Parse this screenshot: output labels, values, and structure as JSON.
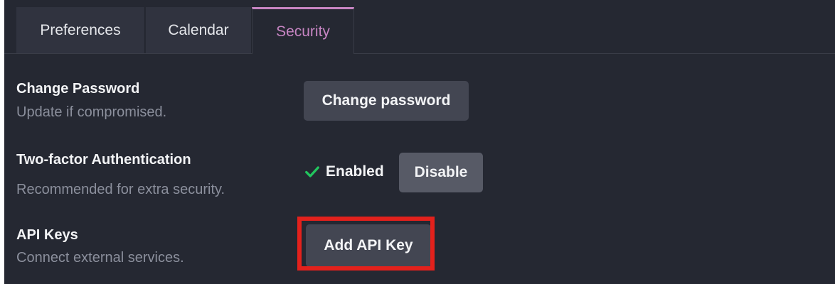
{
  "tabs": [
    {
      "label": "Preferences",
      "active": false
    },
    {
      "label": "Calendar",
      "active": false
    },
    {
      "label": "Security",
      "active": true
    }
  ],
  "security": {
    "password": {
      "title": "Change Password",
      "description": "Update if compromised.",
      "button_label": "Change password"
    },
    "two_factor": {
      "title": "Two-factor Authentication",
      "description": "Recommended for extra security.",
      "status_label": "Enabled",
      "button_label": "Disable"
    },
    "api_keys": {
      "title": "API Keys",
      "description": "Connect external services.",
      "button_label": "Add API Key"
    }
  },
  "colors": {
    "background": "#252832",
    "accent": "#c785c3",
    "success": "#22c55e",
    "highlight": "#e3211c"
  },
  "icons": {
    "status": "check-icon"
  }
}
